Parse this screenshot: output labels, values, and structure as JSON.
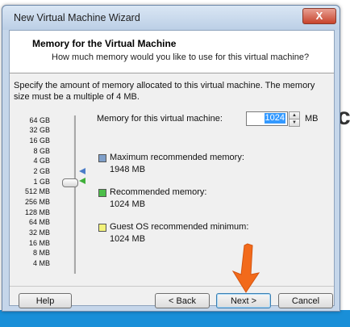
{
  "window": {
    "title": "New Virtual Machine Wizard",
    "close_label": "X"
  },
  "header": {
    "title": "Memory for the Virtual Machine",
    "subtitle": "How much memory would you like to use for this virtual machine?"
  },
  "description": "Specify the amount of memory allocated to this virtual machine. The memory size must be a multiple of 4 MB.",
  "scale": [
    "64 GB",
    "32 GB",
    "16 GB",
    "8 GB",
    "4 GB",
    "2 GB",
    "1 GB",
    "512 MB",
    "256 MB",
    "128 MB",
    "64 MB",
    "32 MB",
    "16 MB",
    "8 MB",
    "4 MB"
  ],
  "memory": {
    "label": "Memory for this virtual machine:",
    "value": "1024",
    "unit": "MB"
  },
  "legend": [
    {
      "title": "Maximum recommended memory:",
      "value": "1948 MB",
      "color": "#7f9fc9"
    },
    {
      "title": "Recommended memory:",
      "value": "1024 MB",
      "color": "#4cbf4a"
    },
    {
      "title": "Guest OS recommended minimum:",
      "value": "1024 MB",
      "color": "#f2f27a"
    }
  ],
  "buttons": {
    "help": "Help",
    "back": "< Back",
    "next": "Next >",
    "cancel": "Cancel"
  },
  "desktop": {
    "partial_letter": "c"
  }
}
